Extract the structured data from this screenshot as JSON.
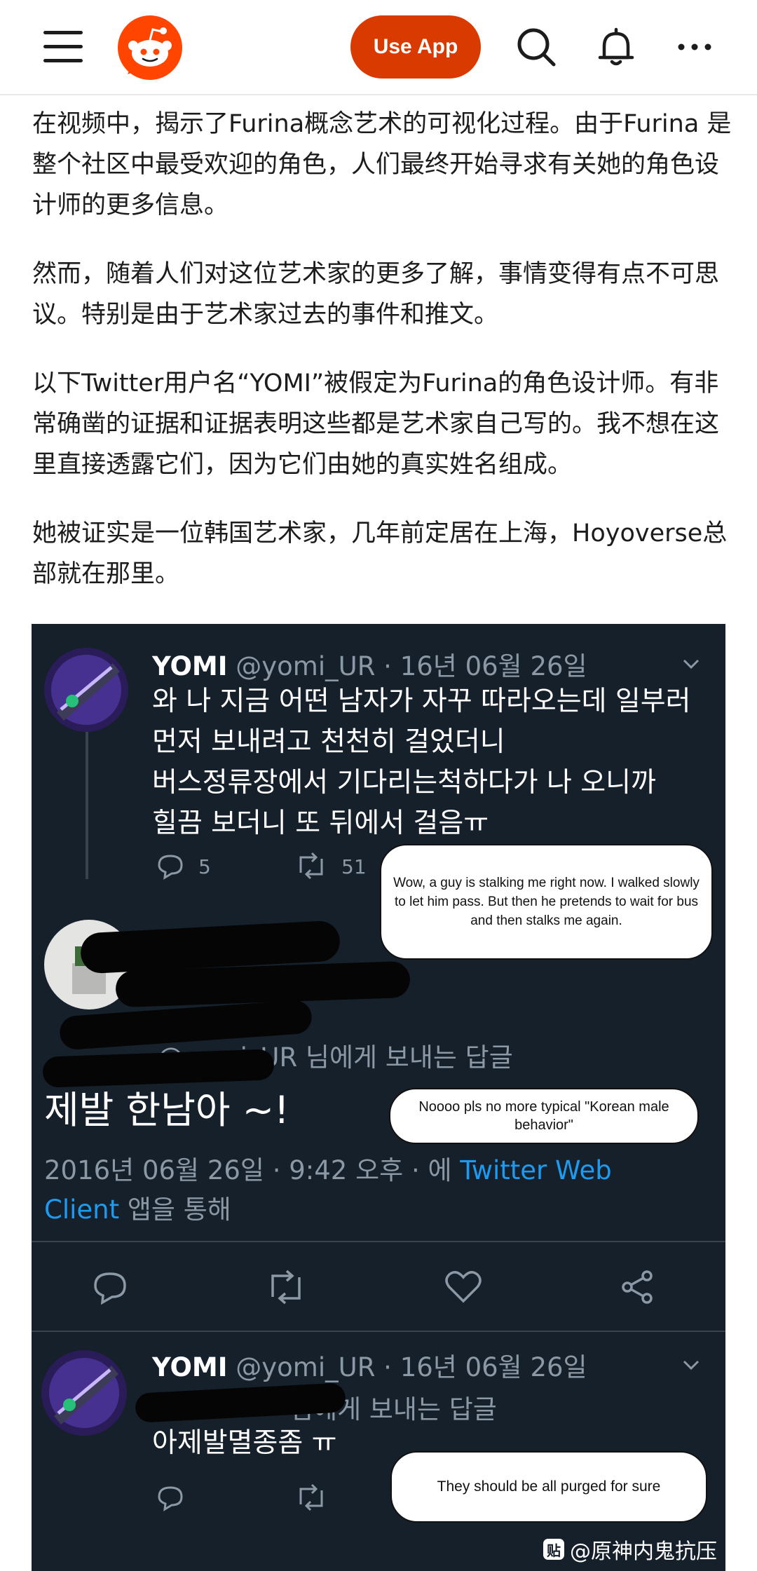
{
  "header": {
    "use_app_label": "Use App",
    "brand_color": "#d93a00"
  },
  "post": {
    "paragraphs": [
      "在视频中，揭示了Furina概念艺术的可视化过程。由于Furina 是整个社区中最受欢迎的角色，人们最终开始寻求有关她的角色设计师的更多信息。",
      "然而，随着人们对这位艺术家的更多了解，事情变得有点不可思议。特别是由于艺术家过去的事件和推文。",
      "以下Twitter用户名“YOMI”被假定为Furina的角色设计师。有非常确凿的证据和证据表明这些都是艺术家自己写的。我不想在这里直接透露它们，因为它们由她的真实姓名组成。",
      "她被证实是一位韩国艺术家，几年前定居在上海，Hoyoverse总部就在那里。"
    ]
  },
  "screenshot": {
    "tweet1": {
      "name": "YOMI",
      "meta": " @yomi_UR · 16년 06월 26일",
      "lines": [
        "와 나 지금 어떤 남자가 자꾸 따라오는데 일부러",
        "먼저 보내려고 천천히 걸었더니",
        "버스정류장에서 기다리는척하다가 나 오니까",
        "힐끔 보더니 또 뒤에서 걸음ㅠ"
      ],
      "replies": "5",
      "retweets": "51"
    },
    "bubble1": "Wow, a guy is stalking me right now. I walked slowly to let him pass. But then he pretends to wait for bus and then stalks me again.",
    "reply": {
      "reply_to": "@yomi_UR 님에게 보내는 답글",
      "text": "제발 한남아 ~!",
      "timestamp": "2016년 06월 26일 · 9:42 오후 · 에 ",
      "client_link": "Twitter Web Client",
      "client_suffix": " 앱을 통해"
    },
    "bubble2": "Noooo pls no more typical \"Korean male behavior\"",
    "tweet2": {
      "name": "YOMI",
      "meta": " @yomi_UR · 16년 06월 26일",
      "reply_to": "님에게 보내는 답글",
      "text": "아제발멸종좀 ㅠ"
    },
    "bubble3": "They should be all purged for sure",
    "watermark": "@原神内鬼抗压"
  }
}
